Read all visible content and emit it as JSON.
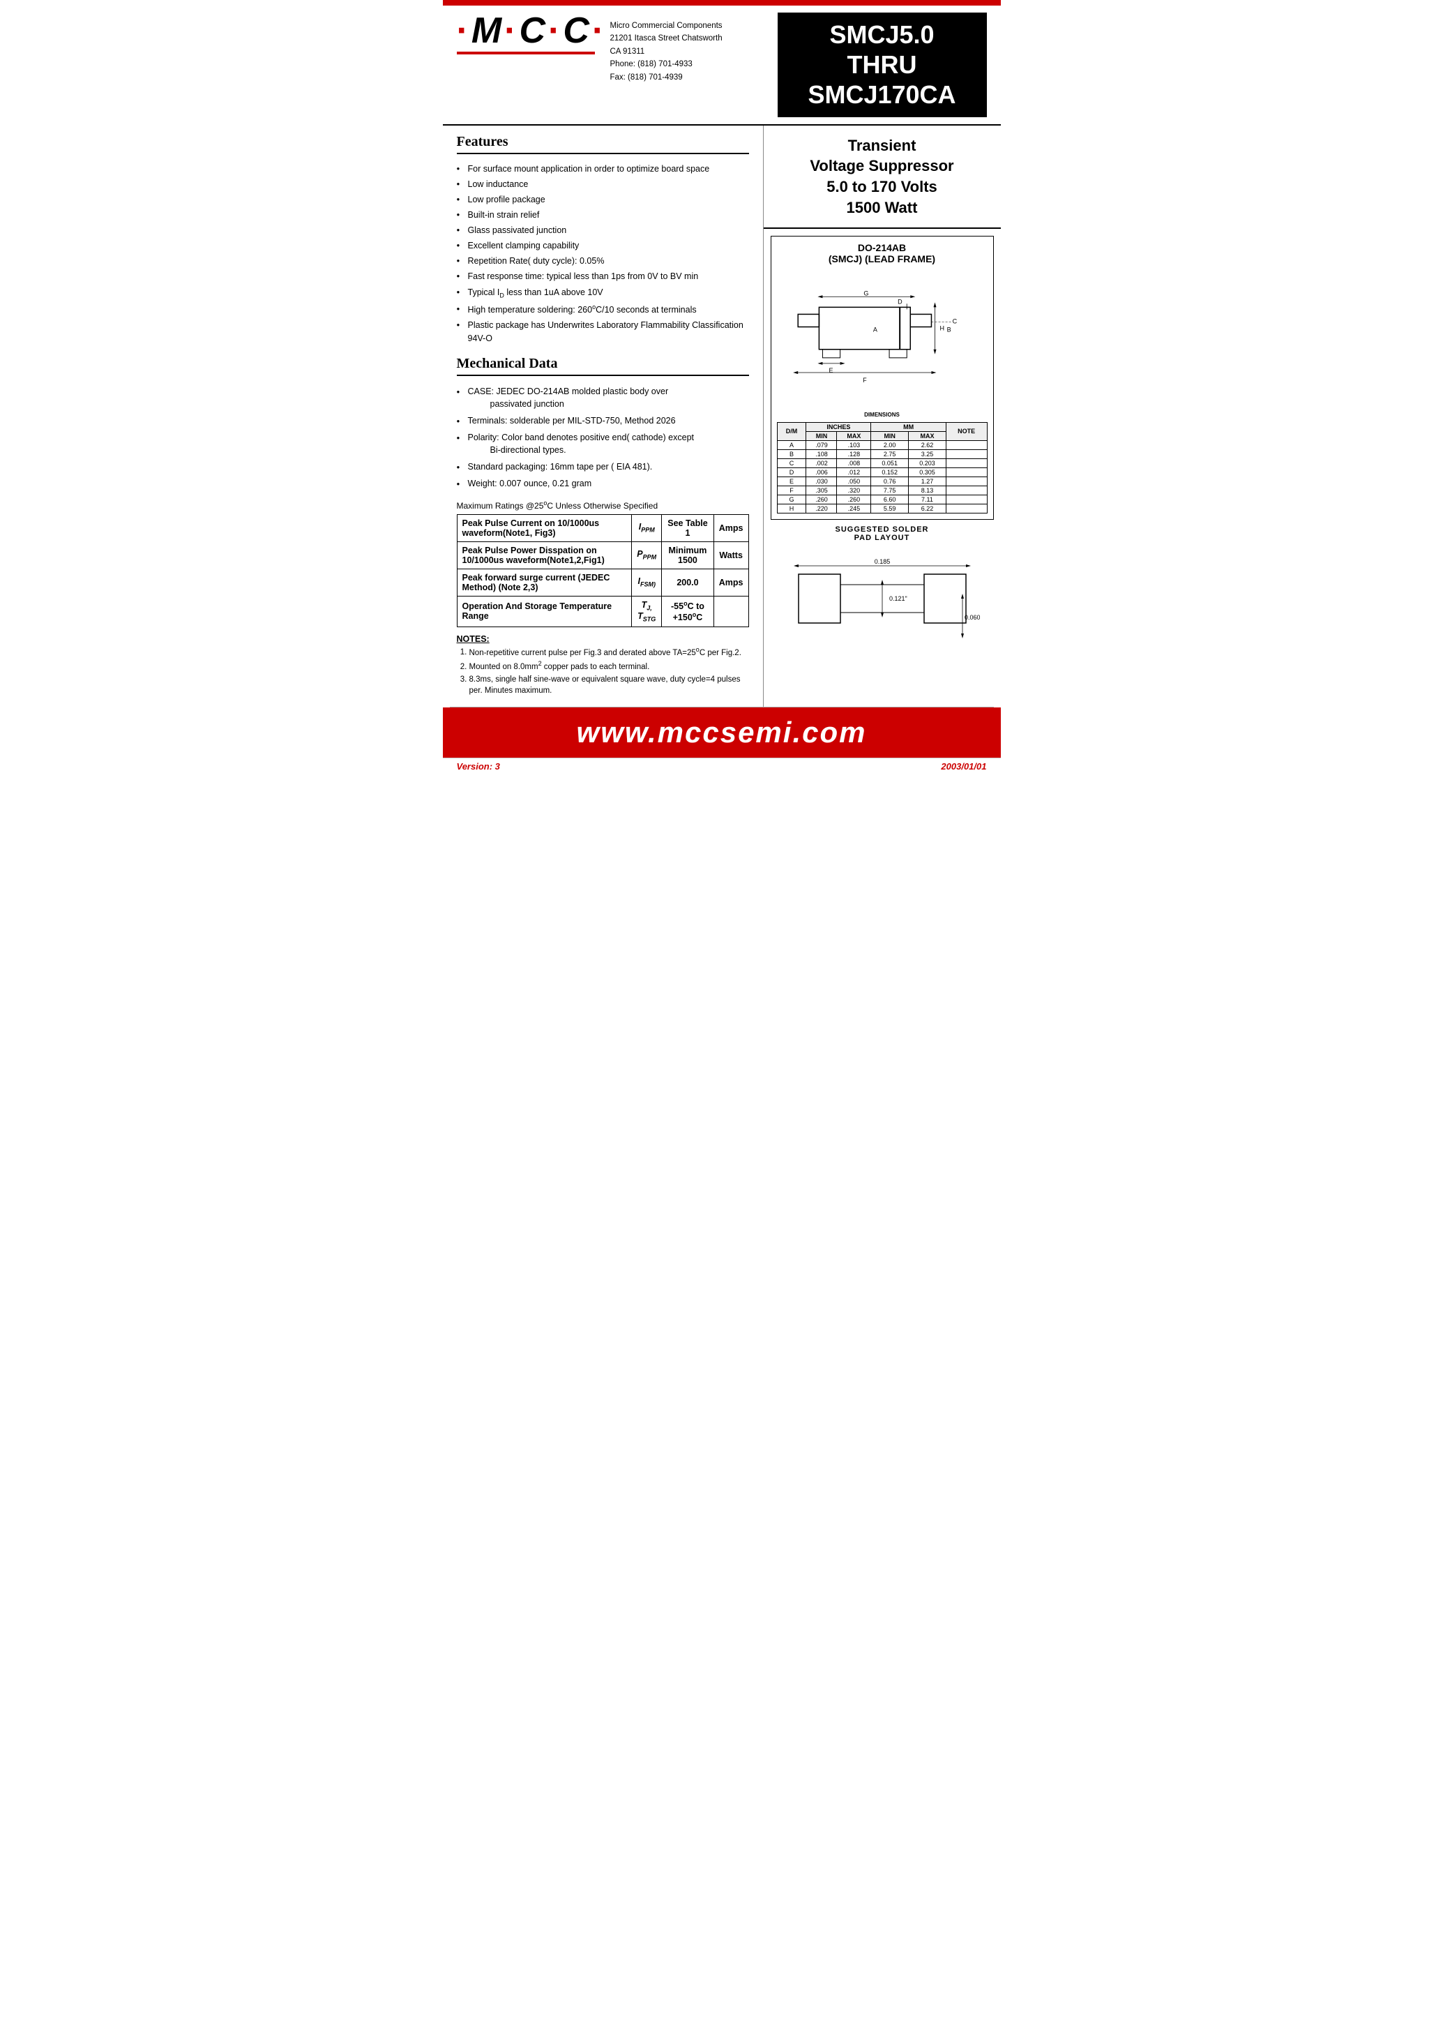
{
  "topBar": {},
  "header": {
    "logo": "·M·C·C·",
    "companyName": "Micro Commercial Components",
    "address1": "21201 Itasca Street Chatsworth",
    "address2": "CA 91311",
    "phone": "Phone: (818) 701-4933",
    "fax": "Fax:    (818) 701-4939",
    "partNumber": "SMCJ5.0\nTHRU\nSMCJ170CA"
  },
  "productDesc": {
    "line1": "Transient",
    "line2": "Voltage Suppressor",
    "line3": "5.0 to 170 Volts",
    "line4": "1500 Watt"
  },
  "packageInfo": {
    "name": "DO-214AB",
    "subname": "(SMCJ) (LEAD FRAME)"
  },
  "features": {
    "title": "Features",
    "items": [
      "For surface mount application in order to optimize board space",
      "Low inductance",
      "Low profile package",
      "Built-in strain relief",
      "Glass passivated junction",
      "Excellent clamping capability",
      "Repetition Rate( duty cycle): 0.05%",
      "Fast response time: typical less than 1ps from 0V to BV min",
      "Typical I₀ less than 1uA above 10V",
      "High temperature soldering: 260°C/10 seconds at terminals",
      "Plastic package has Underwrites Laboratory Flammability Classification 94V-O"
    ]
  },
  "mechanicalData": {
    "title": "Mechanical Data",
    "items": [
      "CASE: JEDEC DO-214AB molded plastic body over passivated junction",
      "Terminals:  solderable per MIL-STD-750, Method 2026",
      "Polarity: Color band denotes positive end( cathode) except Bi-directional types.",
      "Standard packaging: 16mm tape per ( EIA 481).",
      "Weight: 0.007 ounce, 0.21 gram"
    ]
  },
  "maxRatingsNote": "Maximum Ratings @25°C Unless Otherwise Specified",
  "ratingsTable": [
    {
      "description": "Peak Pulse Current on 10/1000us waveform(Note1, Fig3)",
      "symbol": "I",
      "symbolSub": "PPM",
      "value": "See Table 1",
      "unit": "Amps"
    },
    {
      "description": "Peak Pulse Power Disspation on 10/1000us waveform(Note1,2,Fig1)",
      "symbol": "P",
      "symbolSub": "PPM",
      "value": "Minimum\n1500",
      "unit": "Watts"
    },
    {
      "description": "Peak forward surge current (JEDEC Method) (Note 2,3)",
      "symbol": "I",
      "symbolSub": "FSM)",
      "value": "200.0",
      "unit": "Amps"
    },
    {
      "description": "Operation And Storage Temperature Range",
      "symbol": "TJ,\nTSTG",
      "symbolSub": "",
      "value": "-55°C to\n+150°C",
      "unit": ""
    }
  ],
  "notes": {
    "title": "NOTES:",
    "items": [
      "Non-repetitive current pulse per Fig.3 and derated above TA=25°C per Fig.2.",
      "Mounted on 8.0mm² copper pads to each terminal.",
      "8.3ms, single half sine-wave or equivalent square wave, duty cycle=4 pulses per. Minutes maximum."
    ]
  },
  "dimensions": {
    "headers": [
      "D/M",
      "INCHES MIN",
      "INCHES MAX",
      "MM MIN",
      "MM MAX",
      "NOTE"
    ],
    "rows": [
      [
        "A",
        ".079",
        ".103",
        "2.00",
        "2.62",
        ""
      ],
      [
        "B",
        ".108",
        ".128",
        "2.75",
        "3.25",
        ""
      ],
      [
        "C",
        ".002",
        ".008",
        "0.051",
        "0.203",
        ""
      ],
      [
        "D",
        ".006",
        ".012",
        "0.152",
        "0.305",
        ""
      ],
      [
        "E",
        ".030",
        ".050",
        "0.76",
        "1.27",
        ""
      ],
      [
        "F",
        ".305",
        ".320",
        "7.75",
        "8.13",
        ""
      ],
      [
        "G",
        ".260",
        ".260",
        "6.60",
        "7.11",
        ""
      ],
      [
        "H",
        ".220",
        ".245",
        "5.59",
        "6.22",
        ""
      ]
    ]
  },
  "solderPad": {
    "title": "SUGGESTED SOLDER\nPAD LAYOUT",
    "dim1": "0.185",
    "dim2": "0.121\"",
    "dim3": "0.060\""
  },
  "website": "www.mccsemi.com",
  "version": "Version: 3",
  "date": "2003/01/01"
}
